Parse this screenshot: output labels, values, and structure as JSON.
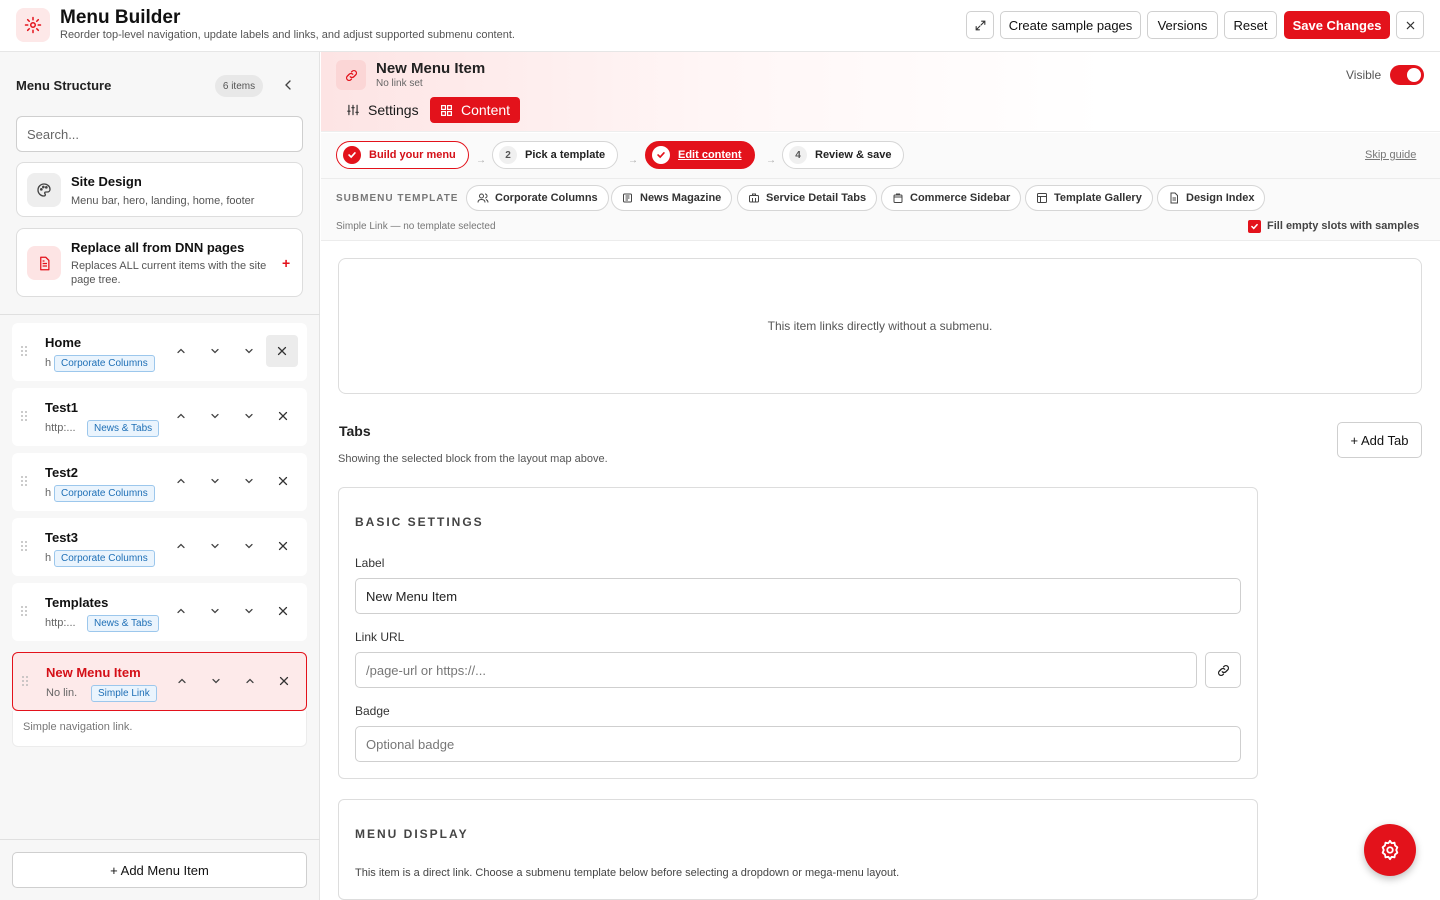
{
  "header": {
    "title": "Menu Builder",
    "subtitle": "Reorder top-level navigation, update labels and links, and adjust supported submenu content.",
    "buttons": {
      "expand_icon": "expand-icon",
      "create_sample": "Create sample pages",
      "versions": "Versions",
      "reset": "Reset",
      "save": "Save Changes",
      "close_icon": "close-icon"
    }
  },
  "colors": {
    "accent": "#e3121b",
    "badge_blue": "#1e6fb6"
  },
  "sidebar": {
    "title": "Menu Structure",
    "count": "6 items",
    "search_placeholder": "Search...",
    "site_design": {
      "title": "Site Design",
      "desc": "Menu bar, hero, landing, home, footer"
    },
    "replace": {
      "title": "Replace all from DNN pages",
      "desc": "Replaces ALL current items with the site page tree.",
      "plus": "+"
    },
    "items": [
      {
        "name": "Home",
        "url": "h",
        "badge": "Corporate Columns"
      },
      {
        "name": "Test1",
        "url": "http:...",
        "badge": "News & Tabs"
      },
      {
        "name": "Test2",
        "url": "h",
        "badge": "Corporate Columns"
      },
      {
        "name": "Test3",
        "url": "h",
        "badge": "Corporate Columns"
      },
      {
        "name": "Templates",
        "url": "http:...",
        "badge": "News & Tabs"
      },
      {
        "name": "New Menu Item",
        "url": "No lin...",
        "badge": "Simple Link"
      }
    ],
    "active_hint": "Simple navigation link.",
    "add_item": "+ Add Menu Item"
  },
  "editor": {
    "title": "New Menu Item",
    "subtitle": "No link set",
    "tabs": {
      "settings": "Settings",
      "content": "Content"
    },
    "visible_label": "Visible",
    "visible": true,
    "steps": [
      {
        "num": "",
        "label": "Build your menu"
      },
      {
        "num": "2",
        "label": "Pick a template"
      },
      {
        "num": "",
        "label": "Edit content"
      },
      {
        "num": "4",
        "label": "Review & save"
      }
    ],
    "step_arrow": "→",
    "skip_guide": "Skip guide",
    "submenu_template_label": "SUBMENU TEMPLATE",
    "templates": [
      "Corporate Columns",
      "News Magazine",
      "Service Detail Tabs",
      "Commerce Sidebar",
      "Template Gallery",
      "Design Index"
    ],
    "template_note": "Simple Link — no template selected",
    "fill_empty_label": "Fill empty slots with samples",
    "fill_empty_checked": true,
    "preview_text": "This item links directly without a submenu.",
    "section_title": "Tabs",
    "section_sub": "Showing the selected block from the layout map above.",
    "add_tab": "+ Add Tab",
    "basic": {
      "heading": "BASIC SETTINGS",
      "label_label": "Label",
      "label_value": "New Menu Item",
      "link_label": "Link URL",
      "link_placeholder": "/page-url or https://...",
      "badge_label": "Badge",
      "badge_placeholder": "Optional badge"
    },
    "display": {
      "heading": "MENU DISPLAY",
      "note": "This item is a direct link. Choose a submenu template below before selecting a dropdown or mega-menu layout."
    }
  }
}
